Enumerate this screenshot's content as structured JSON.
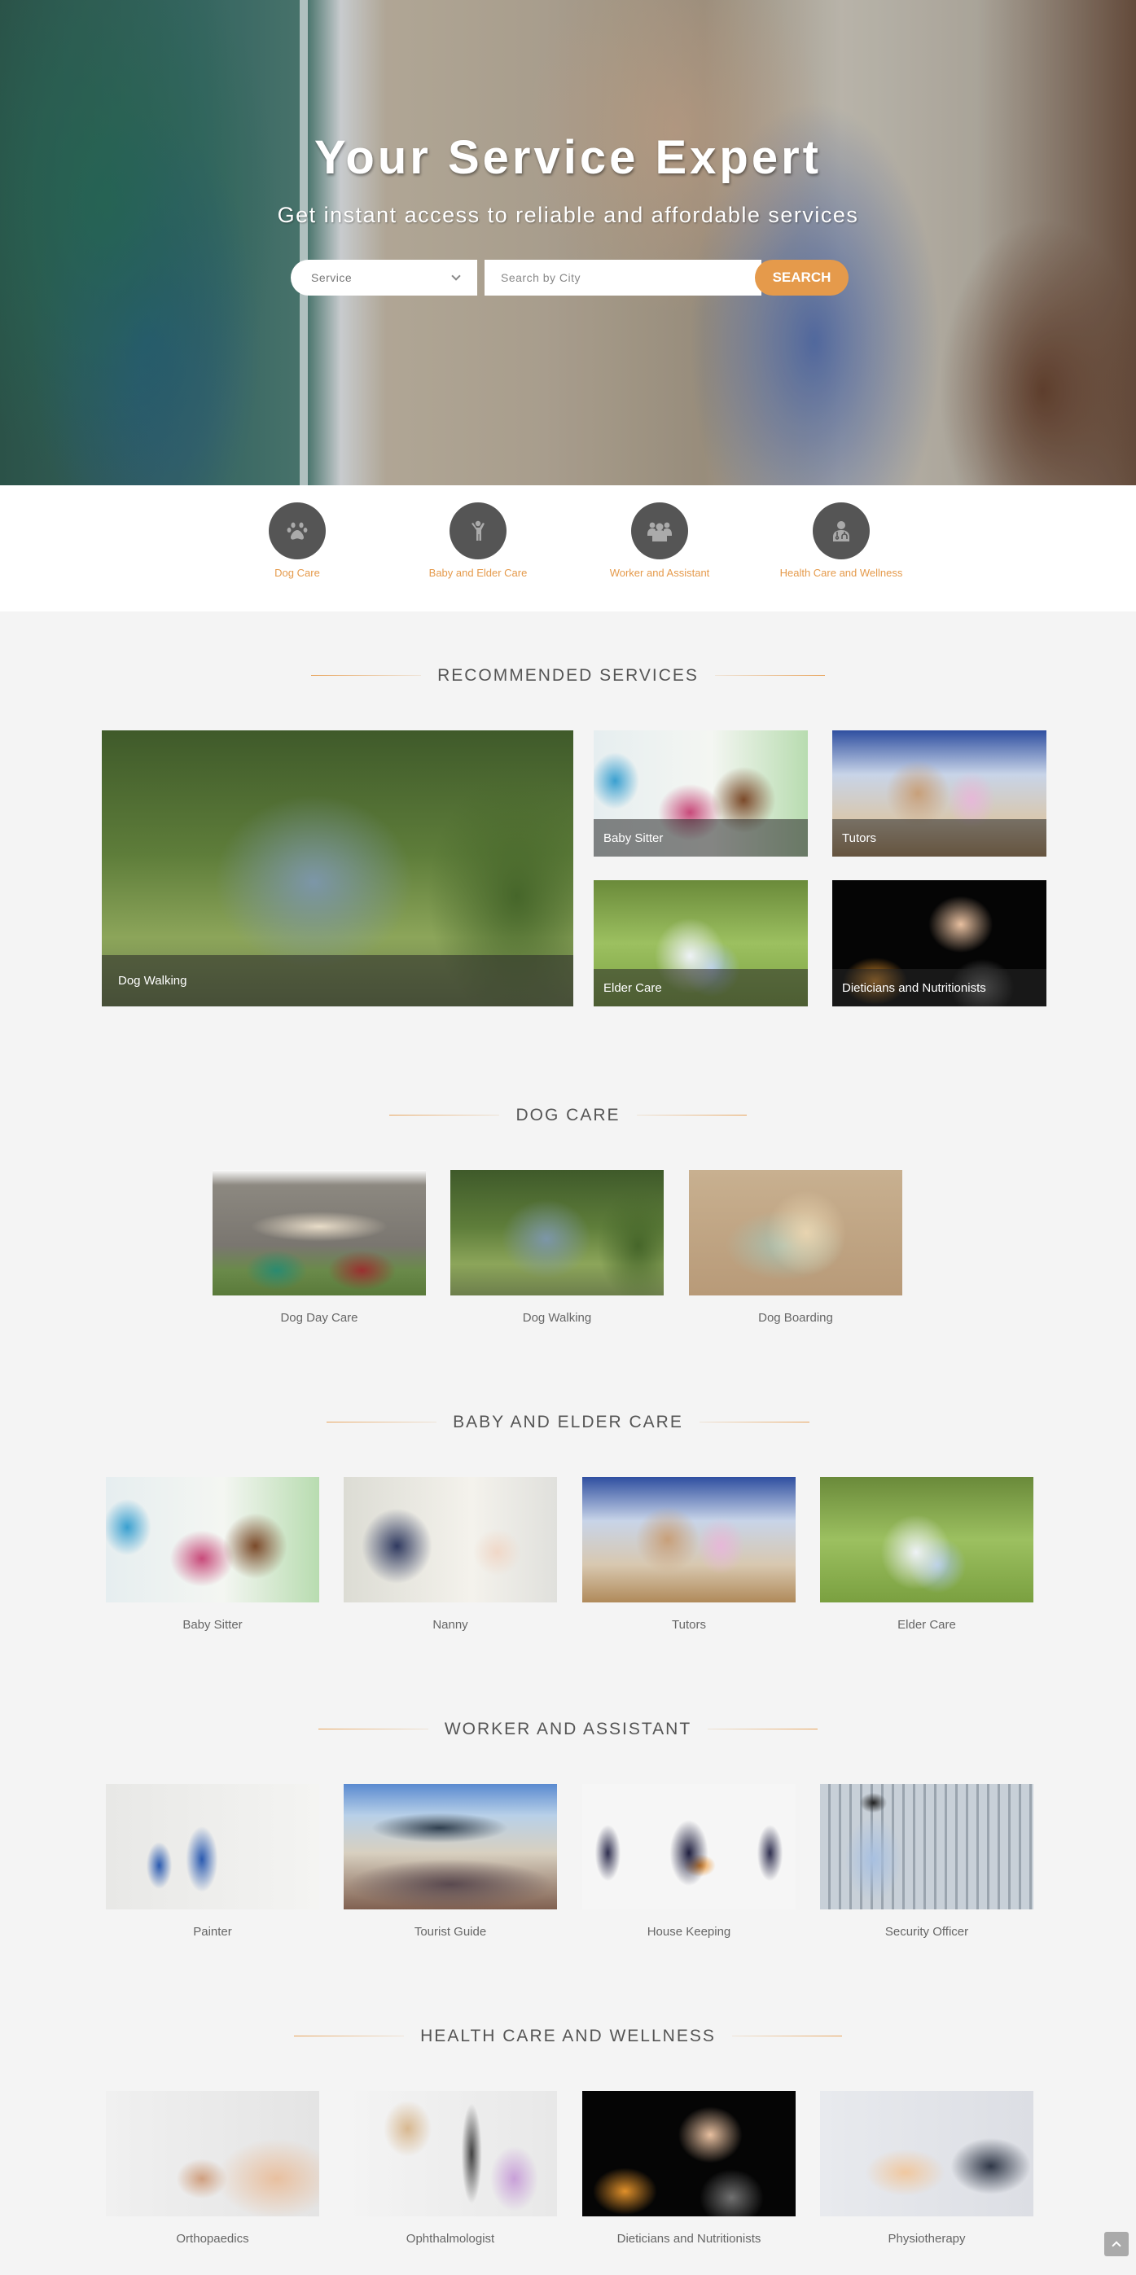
{
  "hero": {
    "title": "Your Service Expert",
    "subtitle": "Get instant access to reliable and affordable services",
    "service_select": {
      "selected": "Service"
    },
    "city_input": {
      "placeholder": "Search by City",
      "value": ""
    },
    "search_button": "SEARCH"
  },
  "categories": [
    {
      "label": "Dog Care",
      "icon": "paw-icon"
    },
    {
      "label": "Baby and Elder Care",
      "icon": "child-icon"
    },
    {
      "label": "Worker and Assistant",
      "icon": "users-icon"
    },
    {
      "label": "Health Care and Wellness",
      "icon": "doctor-icon"
    }
  ],
  "recommended": {
    "title": "RECOMMENDED SERVICES",
    "featured": {
      "label": "Dog Walking"
    },
    "tiles": [
      {
        "label": "Baby Sitter"
      },
      {
        "label": "Tutors"
      },
      {
        "label": "Elder Care"
      },
      {
        "label": "Dieticians and Nutritionists"
      }
    ]
  },
  "sections": {
    "dog_care": {
      "title": "DOG CARE",
      "items": [
        {
          "label": "Dog Day Care"
        },
        {
          "label": "Dog Walking"
        },
        {
          "label": "Dog Boarding"
        }
      ]
    },
    "baby_elder": {
      "title": "BABY AND ELDER CARE",
      "items": [
        {
          "label": "Baby Sitter"
        },
        {
          "label": "Nanny"
        },
        {
          "label": "Tutors"
        },
        {
          "label": "Elder Care"
        }
      ]
    },
    "worker": {
      "title": "WORKER AND ASSISTANT",
      "items": [
        {
          "label": "Painter"
        },
        {
          "label": "Tourist Guide"
        },
        {
          "label": "House Keeping"
        },
        {
          "label": "Security Officer"
        }
      ]
    },
    "health": {
      "title": "HEALTH CARE AND WELLNESS",
      "items": [
        {
          "label": "Orthopaedics"
        },
        {
          "label": "Ophthalmologist"
        },
        {
          "label": "Dieticians and Nutritionists"
        },
        {
          "label": "Physiotherapy"
        }
      ]
    }
  },
  "colors": {
    "accent": "#e59a4b",
    "icon_circle": "#555555",
    "icon_glyph": "#aaaaaa",
    "page_bg": "#f4f4f4"
  }
}
